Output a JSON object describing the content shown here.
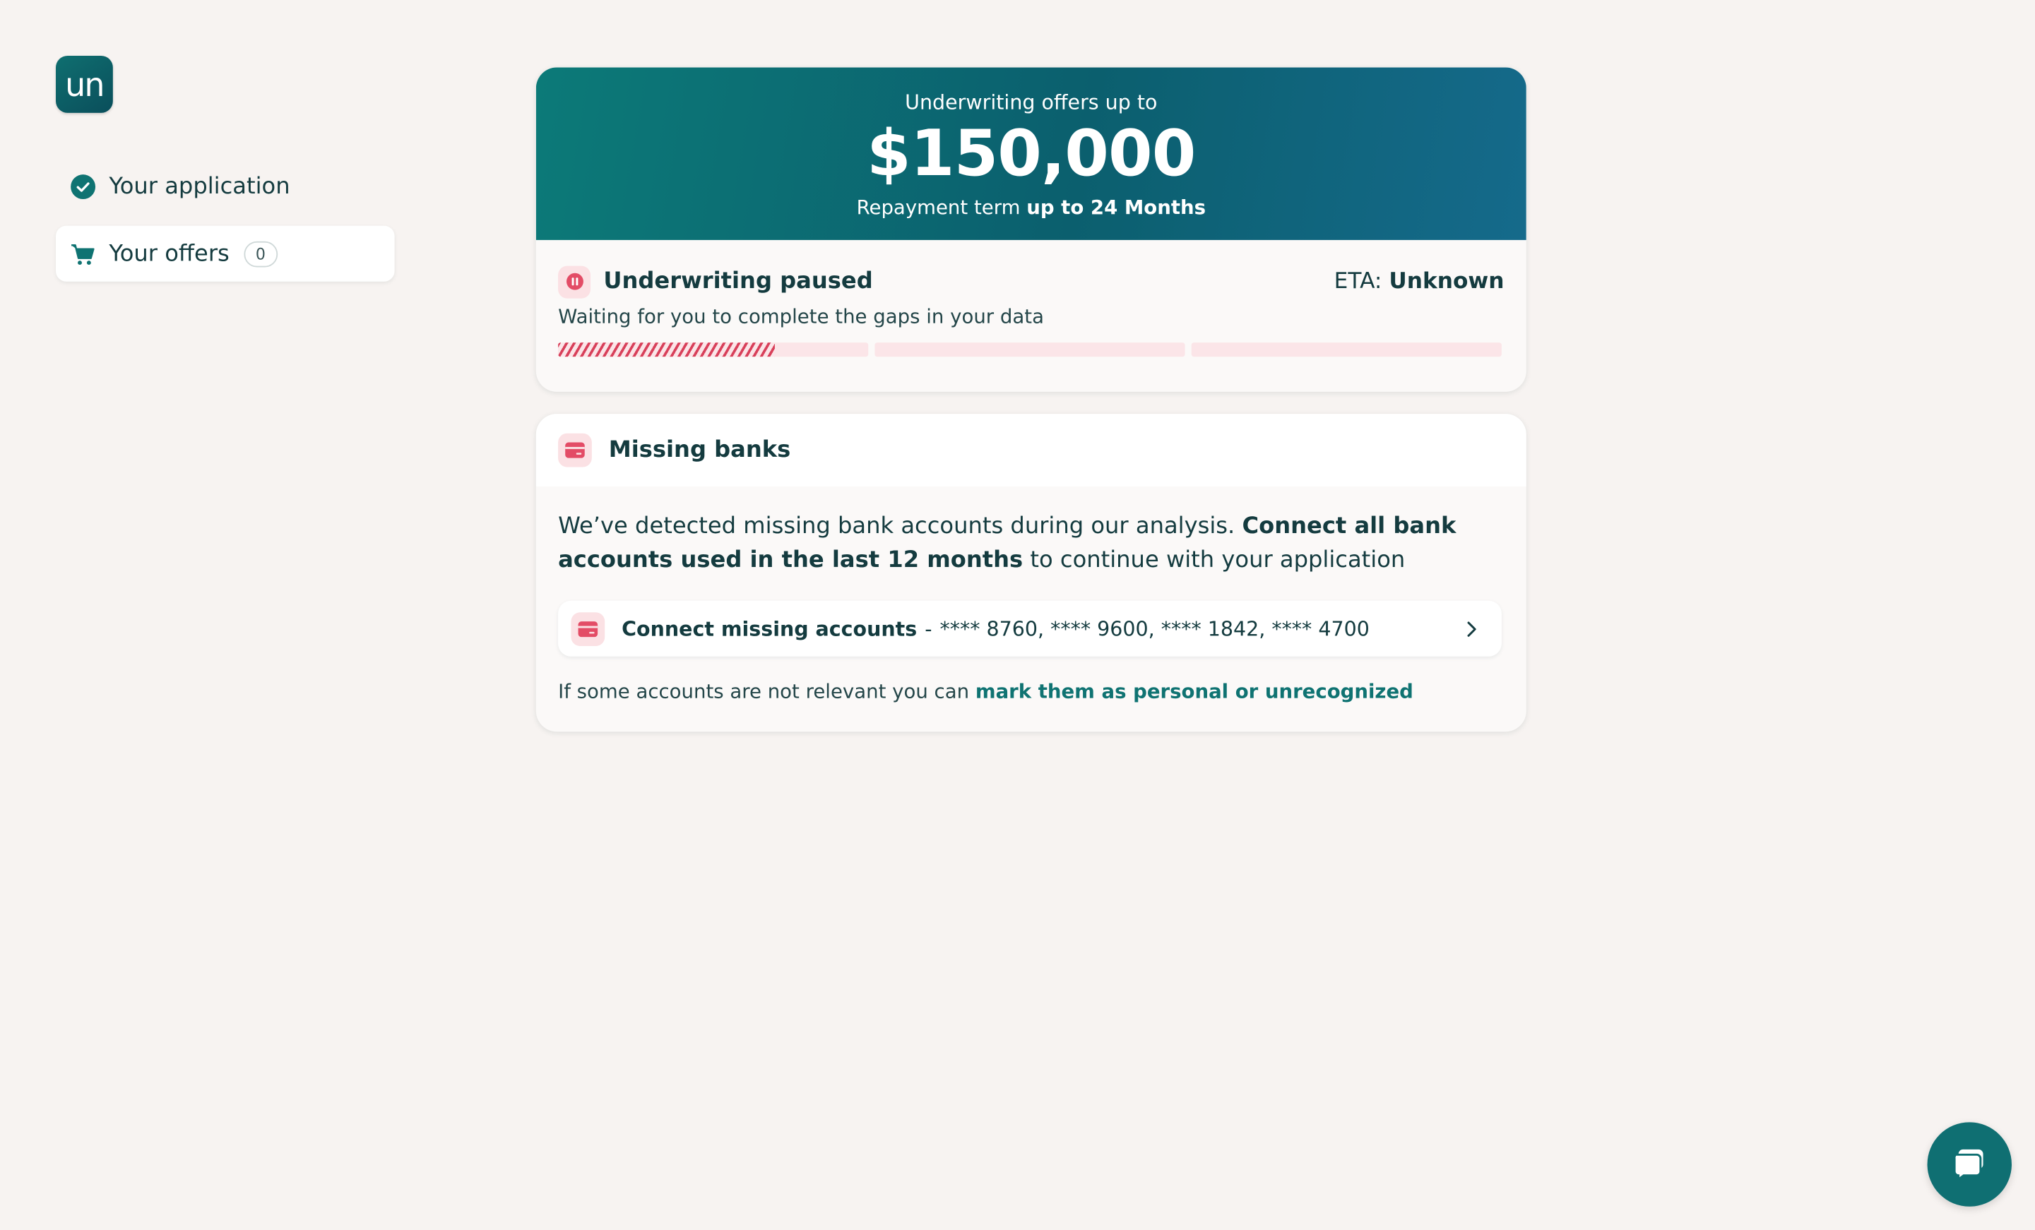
{
  "brand": {
    "logo_text": "un",
    "accent_color": "#0f7372",
    "alert_color": "#d8405a"
  },
  "sidebar": {
    "items": [
      {
        "label": "Your application",
        "icon": "check-circle-icon"
      },
      {
        "label": "Your offers",
        "icon": "cart-icon",
        "badge": "0"
      }
    ]
  },
  "offer": {
    "subtitle": "Underwriting offers up to",
    "amount": "$150,000",
    "term_prefix": "Repayment term",
    "term_value": "up to 24 Months"
  },
  "status": {
    "icon": "pause-icon",
    "title": "Underwriting paused",
    "eta_label": "ETA:",
    "eta_value": "Unknown",
    "description": "Waiting for you to complete the gaps in your data",
    "progress": {
      "segments": 3,
      "first_segment_fill": 0.7
    }
  },
  "missing_banks": {
    "icon": "bank-card-icon",
    "title": "Missing banks",
    "text_plain": "We’ve detected missing bank accounts during our analysis.",
    "text_bold": "Connect all bank accounts used in the last 12 months",
    "text_tail": "to continue with your application",
    "connect": {
      "label": "Connect missing accounts",
      "separator": "-",
      "accounts": "**** 8760, **** 9600, **** 1842, **** 4700"
    },
    "footnote_prefix": "If some accounts are not relevant you can",
    "footnote_link": "mark them as personal or unrecognized"
  },
  "chat": {
    "icon": "chat-icon"
  }
}
